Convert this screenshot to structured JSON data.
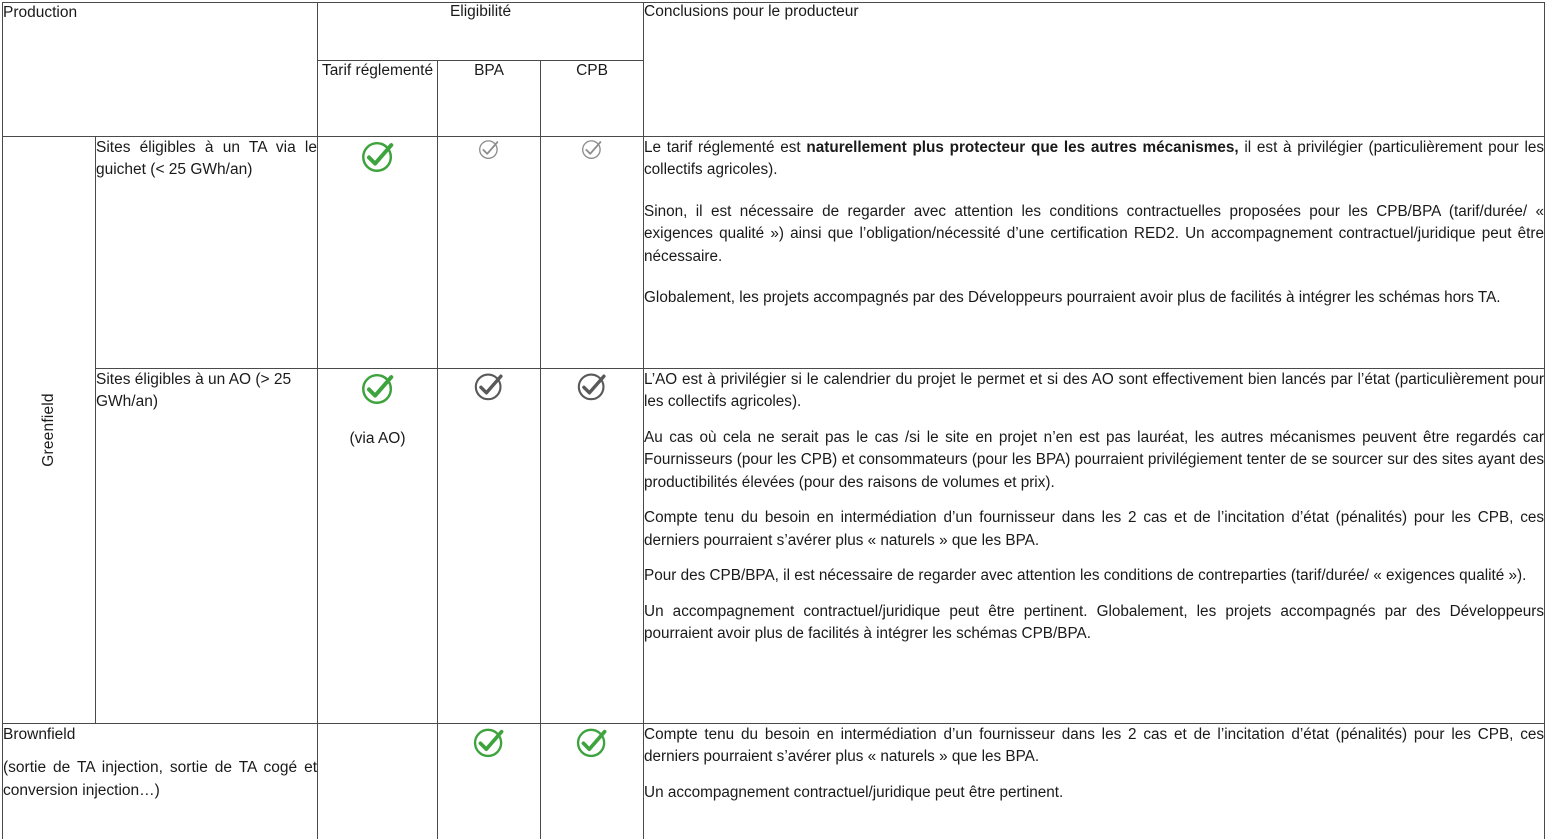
{
  "table": {
    "header": {
      "production": "Production",
      "eligibilite": "Eligibilité",
      "tarif_reglemente": "Tarif réglementé",
      "bpa": "BPA",
      "cpb": "CPB",
      "conclusions": "Conclusions pour le producteur"
    },
    "groups": {
      "greenfield": "Greenfield"
    },
    "rows": [
      {
        "id": "greenfield-guichet",
        "site_label": "Sites éligibles à un TA via le guichet (< 25 GWh/an)",
        "ta": {
          "state": "green-strong",
          "note": ""
        },
        "bpa": {
          "state": "gray-light",
          "note": ""
        },
        "cpb": {
          "state": "gray-light",
          "note": ""
        },
        "conclusions": [
          {
            "lead": "Le tarif réglementé est ",
            "bold": "naturellement plus protecteur que les autres mécanismes,",
            "tail": " il est à privilégier (particulièrement pour les collectifs agricoles)."
          },
          {
            "lead": "Sinon, il est nécessaire de regarder avec attention les conditions contractuelles proposées pour les CPB/BPA (tarif/durée/ « exigences qualité ») ainsi que l’obligation/nécessité d’une certification RED2. Un accompagnement contractuel/juridique peut être nécessaire.",
            "bold": "",
            "tail": ""
          },
          {
            "lead": "Globalement, les projets accompagnés par des Développeurs pourraient avoir plus de facilités à intégrer les schémas hors TA.",
            "bold": "",
            "tail": ""
          }
        ]
      },
      {
        "id": "greenfield-ao",
        "site_label": "Sites éligibles à un AO (> 25 GWh/an)",
        "ta": {
          "state": "green-strong",
          "note": "(via AO)"
        },
        "bpa": {
          "state": "gray-strong",
          "note": ""
        },
        "cpb": {
          "state": "gray-strong",
          "note": ""
        },
        "conclusions": [
          {
            "lead": "L’AO est à privilégier si le calendrier du projet le permet et si des AO sont effectivement bien lancés par l’état (particulièrement pour les collectifs agricoles).",
            "bold": "",
            "tail": ""
          },
          {
            "lead": "Au cas où cela ne serait pas le cas /si le site en projet n’en est pas lauréat, les autres mécanismes peuvent être regardés car Fournisseurs (pour les CPB) et consommateurs (pour les BPA) pourraient privilégiement tenter de se sourcer sur des sites ayant des productibilités élevées (pour des raisons de volumes et prix).",
            "bold": "",
            "tail": ""
          },
          {
            "lead": "Compte tenu du besoin en intermédiation d’un fournisseur dans les 2 cas et de l’incitation d’état (pénalités) pour les CPB, ces derniers pourraient s’avérer plus « naturels » que les BPA.",
            "bold": "",
            "tail": ""
          },
          {
            "lead": "Pour des CPB/BPA, il est nécessaire de regarder avec attention les conditions de contreparties (tarif/durée/ « exigences qualité »).",
            "bold": "",
            "tail": ""
          },
          {
            "lead": "Un accompagnement contractuel/juridique peut être pertinent. Globalement, les projets accompagnés par des Développeurs pourraient avoir plus de facilités à intégrer les schémas CPB/BPA.",
            "bold": "",
            "tail": ""
          }
        ]
      },
      {
        "id": "brownfield",
        "site_label_line1": "Brownfield",
        "site_label_line2": "(sortie de TA injection, sortie de TA cogé et conversion injection…)",
        "ta": {
          "state": "none",
          "note": ""
        },
        "bpa": {
          "state": "green-strong",
          "note": ""
        },
        "cpb": {
          "state": "green-strong",
          "note": ""
        },
        "conclusions": [
          {
            "lead": "Compte tenu du besoin en intermédiation d’un fournisseur dans les 2 cas et de l’incitation d’état (pénalités) pour les CPB, ces derniers pourraient  s’avérer plus « naturels » que les BPA.",
            "bold": "",
            "tail": ""
          },
          {
            "lead": "Un accompagnement contractuel/juridique peut être pertinent.",
            "bold": "",
            "tail": ""
          }
        ]
      }
    ]
  },
  "colors": {
    "check_green": "#3DA33D",
    "check_gray_strong": "#595959",
    "check_gray_light": "#8C8C8C",
    "border": "#4a4a4a",
    "text": "#1a1a1a"
  },
  "icons": {
    "check_circle": "circle-check-icon"
  }
}
